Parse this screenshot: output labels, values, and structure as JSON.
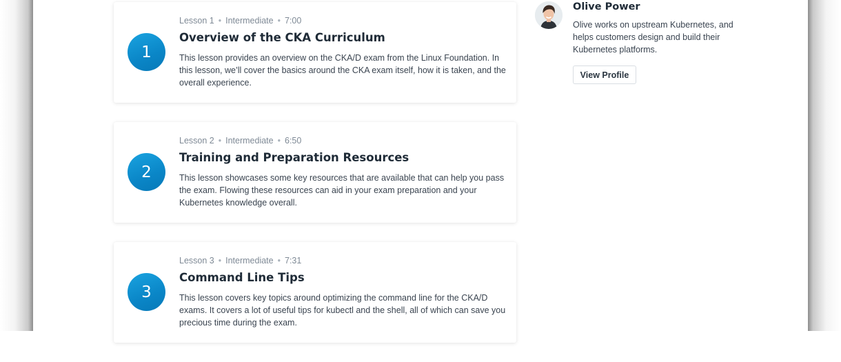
{
  "lessons": [
    {
      "number": "1",
      "label": "Lesson 1",
      "level": "Intermediate",
      "duration": "7:00",
      "title": "Overview of the CKA Curriculum",
      "description": "This lesson provides an overview on the CKA/D exam from the Linux Foundation. In this lesson, we’ll cover the basics around the CKA exam itself, how it is taken, and the overall experience."
    },
    {
      "number": "2",
      "label": "Lesson 2",
      "level": "Intermediate",
      "duration": "6:50",
      "title": "Training and Preparation Resources",
      "description": "This lesson showcases some key resources that are available that can help you pass the exam. Flowing these resources can aid in your exam preparation and your Kubernetes knowledge overall."
    },
    {
      "number": "3",
      "label": "Lesson 3",
      "level": "Intermediate",
      "duration": "7:31",
      "title": "Command Line Tips",
      "description": "This lesson covers key topics around optimizing the command line for the CKA/D exams. It covers a lot of useful tips for kubectl and the shell, all of which can save you precious time during the exam."
    }
  ],
  "author": {
    "name": "Olive Power",
    "bio": "Olive works on upstream Kubernetes, and helps customers design and build their Kubernetes platforms.",
    "button_label": "View Profile",
    "avatar_icon": "person-avatar-icon"
  },
  "meta_separator": "•",
  "colors": {
    "accent": "#0a8ccc",
    "title": "#1f2b37",
    "meta": "#7f8a96"
  }
}
